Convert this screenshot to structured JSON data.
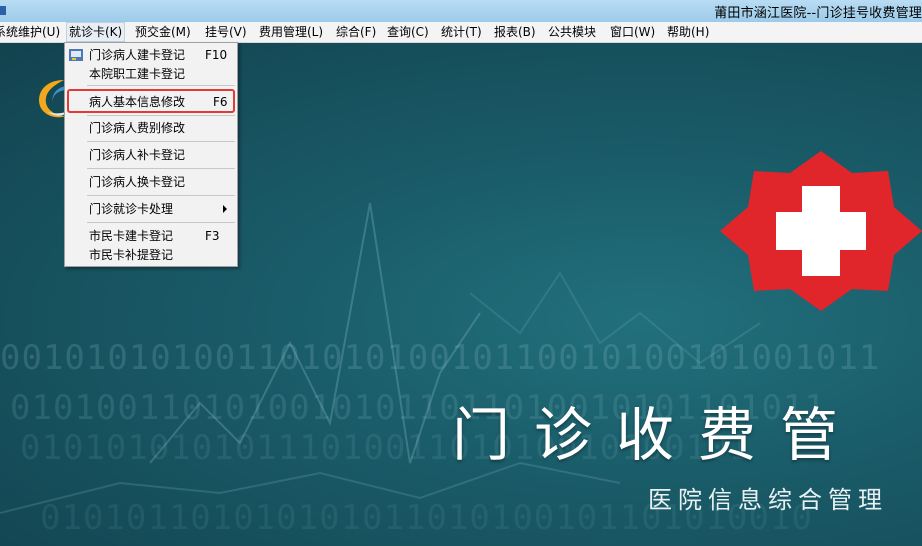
{
  "window": {
    "title": "莆田市涵江医院--门诊挂号收费管理"
  },
  "menubar": {
    "items": [
      {
        "id": "system",
        "label": "系统维护(U)"
      },
      {
        "id": "card",
        "label": "就诊卡(K)"
      },
      {
        "id": "prepay",
        "label": "预交金(M)"
      },
      {
        "id": "register",
        "label": "挂号(V)"
      },
      {
        "id": "fee",
        "label": "费用管理(L)"
      },
      {
        "id": "general",
        "label": "综合(F)"
      },
      {
        "id": "query",
        "label": "查询(C)"
      },
      {
        "id": "stats",
        "label": "统计(T)"
      },
      {
        "id": "report",
        "label": "报表(B)"
      },
      {
        "id": "public",
        "label": "公共模块"
      },
      {
        "id": "window",
        "label": "窗口(W)"
      },
      {
        "id": "help",
        "label": "帮助(H)"
      }
    ]
  },
  "card_menu": {
    "items": [
      {
        "label": "门诊病人建卡登记",
        "shortcut": "F10"
      },
      {
        "label": "本院职工建卡登记",
        "shortcut": ""
      },
      {
        "label": "病人基本信息修改",
        "shortcut": "F6"
      },
      {
        "label": "门诊病人费别修改",
        "shortcut": ""
      },
      {
        "label": "门诊病人补卡登记",
        "shortcut": ""
      },
      {
        "label": "门诊病人换卡登记",
        "shortcut": ""
      },
      {
        "label": "门诊就诊卡处理",
        "shortcut": ""
      },
      {
        "label": "市民卡建卡登记",
        "shortcut": "F3"
      },
      {
        "label": "市民卡补提登记",
        "shortcut": ""
      }
    ]
  },
  "background": {
    "title": "门诊收费管",
    "subtitle": "医院信息综合管理",
    "binary_rows": [
      "00101010100110101010010110010100101001011",
      "01010011010100101011011010010101101011",
      "0101010101011101001101010010100101",
      "010101101010101011010100101101010010"
    ]
  },
  "colors": {
    "titlebar": "#9ccbea",
    "menubar": "#f4f4f4",
    "desktop": "#15505e",
    "highlight_border": "#e53935",
    "cross_red": "#e0262a"
  }
}
